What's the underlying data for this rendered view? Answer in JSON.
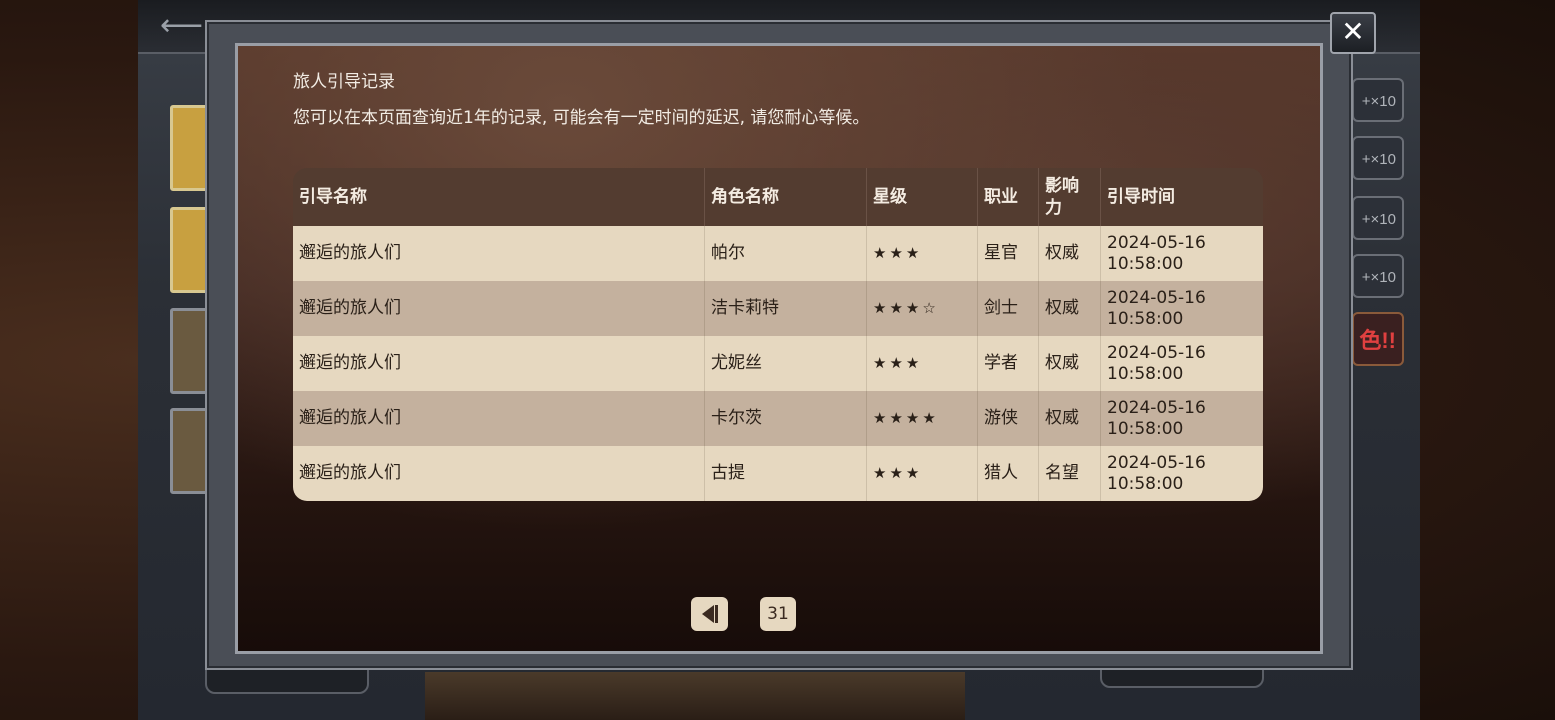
{
  "dialog": {
    "title": "旅人引导记录",
    "subtitle": "您可以在本页面查询近1年的记录, 可能会有一定时间的延迟, 请您耐心等候。",
    "close_icon": "close-icon",
    "close_label": "✕"
  },
  "table": {
    "headers": [
      "引导名称",
      "角色名称",
      "星级",
      "职业",
      "影响力",
      "引导时间"
    ],
    "rows": [
      {
        "name": "邂逅的旅人们",
        "character": "帕尔",
        "stars": "★★★",
        "job": "星官",
        "influence": "权威",
        "date": "2024-05-16",
        "time": "10:58:00"
      },
      {
        "name": "邂逅的旅人们",
        "character": "洁卡莉特",
        "stars": "★★★☆",
        "job": "剑士",
        "influence": "权威",
        "date": "2024-05-16",
        "time": "10:58:00"
      },
      {
        "name": "邂逅的旅人们",
        "character": "尤妮丝",
        "stars": "★★★",
        "job": "学者",
        "influence": "权威",
        "date": "2024-05-16",
        "time": "10:58:00"
      },
      {
        "name": "邂逅的旅人们",
        "character": "卡尔茨",
        "stars": "★★★★",
        "job": "游侠",
        "influence": "权威",
        "date": "2024-05-16",
        "time": "10:58:00"
      },
      {
        "name": "邂逅的旅人们",
        "character": "古提",
        "stars": "★★★",
        "job": "猎人",
        "influence": "名望",
        "date": "2024-05-16",
        "time": "10:58:00"
      }
    ]
  },
  "pagination": {
    "prev_icon": "prev-page-icon",
    "page": "31"
  },
  "background": {
    "right_buttons": [
      "+×10",
      "+×10",
      "+×10",
      "+×10",
      "色!!"
    ],
    "back_icon": "back-arrow-icon",
    "back_glyph": "⟵"
  },
  "colors": {
    "header_row": "#533c30",
    "row_light": "#e6d8c0",
    "row_dark": "#c4b19e",
    "title_text": "#f2ece4"
  }
}
